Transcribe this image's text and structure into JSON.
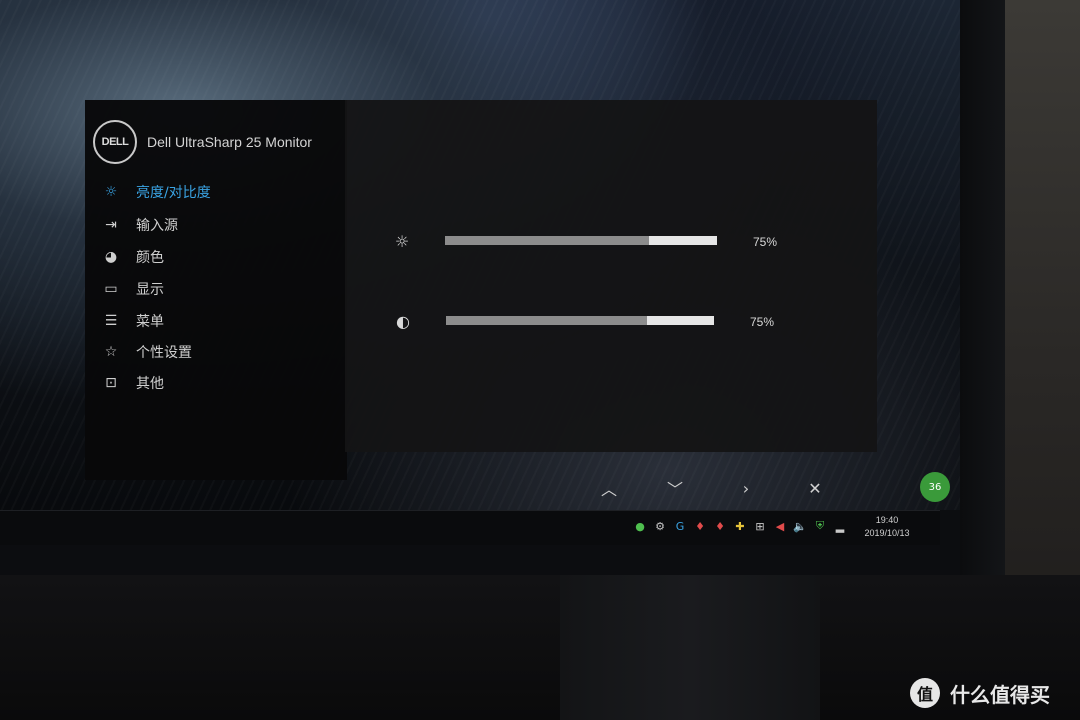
{
  "monitor": {
    "brand_logo": "DELL",
    "title": "Dell UltraSharp 25 Monitor"
  },
  "menu": [
    {
      "label": "亮度/对比度",
      "icon": "brightness-icon",
      "active": true
    },
    {
      "label": "输入源",
      "icon": "input-source-icon",
      "active": false
    },
    {
      "label": "颜色",
      "icon": "color-palette-icon",
      "active": false
    },
    {
      "label": "显示",
      "icon": "display-icon",
      "active": false
    },
    {
      "label": "菜单",
      "icon": "menu-icon",
      "active": false
    },
    {
      "label": "个性设置",
      "icon": "star-icon",
      "active": false
    },
    {
      "label": "其他",
      "icon": "other-icon",
      "active": false
    }
  ],
  "settings": {
    "brightness": {
      "value": 75,
      "label": "75%",
      "icon": "sun-icon"
    },
    "contrast": {
      "value": 75,
      "label": "75%",
      "icon": "contrast-icon"
    }
  },
  "nav_buttons": [
    {
      "name": "up-button",
      "icon": "chevron-up-icon"
    },
    {
      "name": "down-button",
      "icon": "chevron-down-icon"
    },
    {
      "name": "right-button",
      "icon": "chevron-right-icon"
    },
    {
      "name": "close-button",
      "icon": "close-icon"
    }
  ],
  "taskbar": {
    "badge": "36",
    "time": "19:40",
    "date": "2019/10/13"
  },
  "watermark": {
    "logo": "值",
    "text": "什么值得买"
  },
  "colors": {
    "active": "#3aa3e3",
    "text": "#cfcfcf",
    "bar_track": "#e6e6e6",
    "bar_fill": "#8c8c8c"
  }
}
